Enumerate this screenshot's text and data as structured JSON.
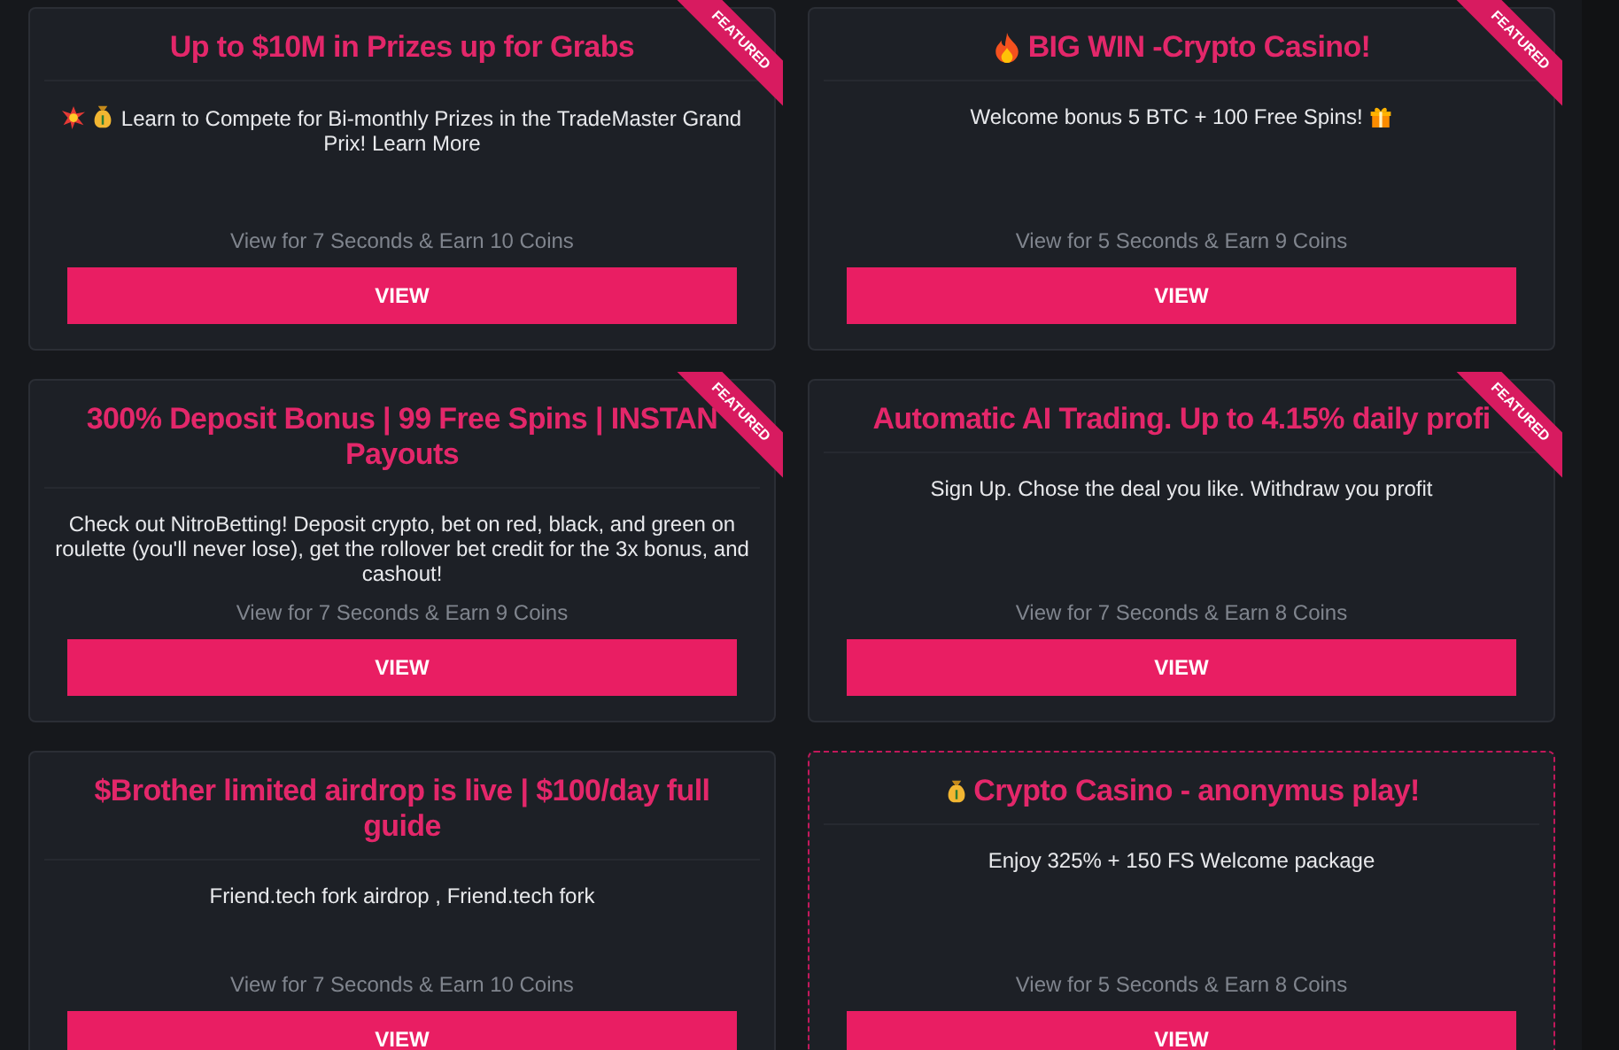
{
  "cards": [
    {
      "title": {
        "lines": [
          "Up to $10M in Prizes up for Grabs"
        ]
      },
      "description": {
        "text": "Learn to Compete for Bi-monthly Prizes in the TradeMaster Grand Prix! Learn More",
        "icons_before": [
          {
            "kind": "burst"
          },
          {
            "kind": "moneybag"
          }
        ]
      },
      "reward": "View for 7 Seconds & Earn 10 Coins",
      "button": "VIEW",
      "ribbon": "FEATURED",
      "selected": false
    },
    {
      "title": {
        "lines": [
          "BIG WIN -Crypto Casino!"
        ],
        "icon_before": {
          "kind": "fire"
        }
      },
      "description": {
        "text": "Welcome bonus 5 BTC + 100 Free Spins!",
        "icons_after": [
          {
            "kind": "gift"
          }
        ]
      },
      "reward": "View for 5 Seconds & Earn 9 Coins",
      "button": "VIEW",
      "ribbon": "FEATURED",
      "selected": false
    },
    {
      "title": {
        "lines": [
          "300% Deposit Bonus | 99 Free Spins | INSTAN",
          "Payouts"
        ]
      },
      "description": {
        "text": "Check out NitroBetting! Deposit crypto, bet on red, black, and green on roulette (you'll never lose), get the rollover bet credit for the 3x bonus, and cashout!"
      },
      "reward": "View for 7 Seconds & Earn 9 Coins",
      "button": "VIEW",
      "ribbon": "FEATURED",
      "selected": false
    },
    {
      "title": {
        "lines": [
          "Automatic AI Trading. Up to 4.15% daily profi"
        ]
      },
      "description": {
        "text": "Sign Up. Chose the deal you like. Withdraw you profit"
      },
      "reward": "View for 7 Seconds & Earn 8 Coins",
      "button": "VIEW",
      "ribbon": "FEATURED",
      "selected": false
    },
    {
      "title": {
        "lines": [
          "$Brother limited airdrop is live | $100/day full",
          "guide"
        ]
      },
      "description": {
        "text": "Friend.tech fork airdrop , Friend.tech fork"
      },
      "reward": "View for 7 Seconds & Earn 10 Coins",
      "button": "VIEW",
      "selected": false
    },
    {
      "title": {
        "lines": [
          "Crypto Casino - anonymus play!"
        ],
        "icon_before": {
          "kind": "moneybag"
        }
      },
      "description": {
        "text": "Enjoy 325% + 150 FS Welcome package"
      },
      "reward": "View for 5 Seconds & Earn 8 Coins",
      "button": "VIEW",
      "selected": true
    }
  ]
}
